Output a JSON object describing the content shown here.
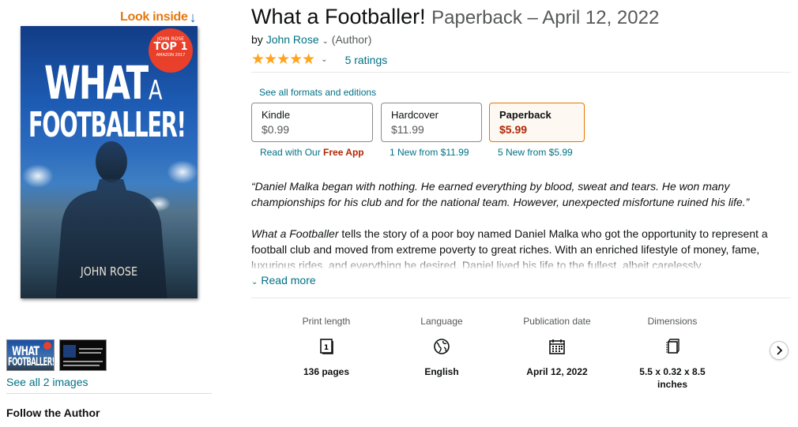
{
  "look_inside": {
    "label": "Look inside",
    "arrow": "↓"
  },
  "cover": {
    "badge_line1": "JOHN ROSE",
    "badge_line2": "TOP 1",
    "badge_line3": "AMAZON 2017",
    "title_word1": "WHAT",
    "title_word2": "A",
    "title_word3": "FOOTBALLER!",
    "author": "JOHN ROSE"
  },
  "thumbnails": {
    "see_all": "See all 2 images"
  },
  "follow_author": "Follow the Author",
  "product": {
    "title": "What a Footballer!",
    "format_date": "Paperback – April 12, 2022",
    "by": "by",
    "author": "John Rose",
    "author_role": "(Author)",
    "stars": "★★★★★",
    "ratings": "5 ratings"
  },
  "formats": {
    "see_all_link": "See all formats and editions",
    "items": [
      {
        "name": "Kindle",
        "price": "$0.99",
        "sub_prefix": "Read with Our ",
        "sub_bold": "Free App"
      },
      {
        "name": "Hardcover",
        "price": "$11.99",
        "sub": "1 New from $11.99"
      },
      {
        "name": "Paperback",
        "price": "$5.99",
        "sub": "5 New from $5.99",
        "selected": true
      }
    ]
  },
  "description": {
    "quote": "“Daniel Malka began with nothing. He earned everything by blood, sweat and tears. He won many championships for his club and for the national team. However, unexpected misfortune ruined his life.”",
    "body_italic": "What a Footballer",
    "body": " tells the story of a poor boy named Daniel Malka who got the opportunity to represent a football club and moved from extreme poverty to great riches. With an enriched lifestyle of money, fame, luxurious rides, and everything he desired, Daniel lived his life to the fullest, albeit carelessly.",
    "read_more": "Read more"
  },
  "details": [
    {
      "label": "Print length",
      "icon": "page-count-icon",
      "value": "136 pages"
    },
    {
      "label": "Language",
      "icon": "globe-icon",
      "value": "English"
    },
    {
      "label": "Publication date",
      "icon": "calendar-icon",
      "value": "April 12, 2022"
    },
    {
      "label": "Dimensions",
      "icon": "dimensions-icon",
      "value": "5.5 x 0.32 x 8.5 inches"
    }
  ],
  "colors": {
    "link": "#007185",
    "price_red": "#b12704",
    "star": "#ffa41c",
    "selected_border": "#e77600",
    "look_inside": "#e47911"
  }
}
